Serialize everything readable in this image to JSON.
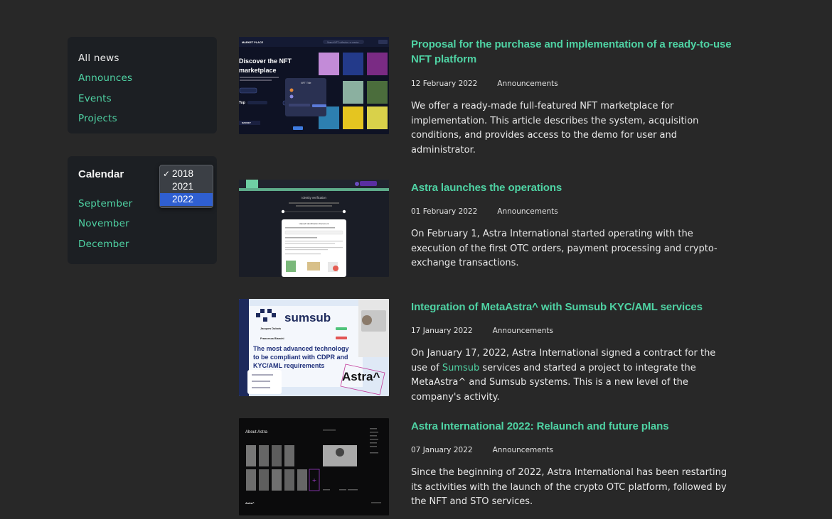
{
  "nav": {
    "items": [
      {
        "label": "All news",
        "active": true
      },
      {
        "label": "Announces",
        "active": false
      },
      {
        "label": "Events",
        "active": false
      },
      {
        "label": "Projects",
        "active": false
      }
    ]
  },
  "calendar": {
    "title": "Calendar",
    "years": [
      "2018",
      "2021",
      "2022"
    ],
    "checked_year": "2018",
    "highlighted_year": "2022",
    "months": [
      "September",
      "November",
      "December"
    ]
  },
  "thumbs": {
    "nft": {
      "brand": "MARKET PLACE",
      "headline_1": "Discover the NFT",
      "headline_2": "marketplace",
      "search": "Search NFT, collection, or creator",
      "card_title": "NFT Title",
      "top": "Top"
    },
    "verify": {
      "title": "Identity verification",
      "card_title": "Upload Identification Document"
    },
    "sumsub": {
      "brand": "sumsub",
      "tagline_1": "The most advanced technology",
      "tagline_2": "to be compliant with CDPR and",
      "tagline_3": "KYC/AML requirements",
      "astra": "Astra^",
      "person_1": "Jacques Dubois",
      "person_2": "Francesca Bianchi"
    },
    "about": {
      "title": "About Astra",
      "footer": "Astra^"
    }
  },
  "articles": [
    {
      "title": "Proposal for the purchase and implementation of a ready-to-use NFT platform",
      "date": "12 February 2022",
      "category": "Announcements",
      "text": "We offer a ready-made full-featured NFT marketplace for implementation. This article describes the system, acquisition conditions, and provides access to the demo for user and administrator."
    },
    {
      "title": "Astra launches the operations",
      "date": "01 February 2022",
      "category": "Announcements",
      "text": "On February 1, Astra International started operating with the execution of the first OTC orders, payment processing and crypto-exchange transactions."
    },
    {
      "title": "Integration of MetaAstra^ with Sumsub KYC/AML services",
      "date": "17 January 2022",
      "category": "Announcements",
      "text_pre": "On January 17, 2022, Astra International signed a contract for the use of ",
      "text_link": "Sumsub",
      "text_post": " services and started a project to integrate the MetaAstra^ and Sumsub systems. This is a new level of the company's activity."
    },
    {
      "title": "Astra International 2022: Relaunch and future plans",
      "date": "07 January 2022",
      "category": "Announcements",
      "text": "Since the beginning of 2022, Astra International has been restarting its activities with the launch of the crypto OTC platform, followed by the NFT and STO services."
    }
  ],
  "colors": {
    "background": "#282828",
    "panel": "#1c1f23",
    "accent": "#4fd3a4",
    "select_highlight": "#2f5fd0"
  }
}
